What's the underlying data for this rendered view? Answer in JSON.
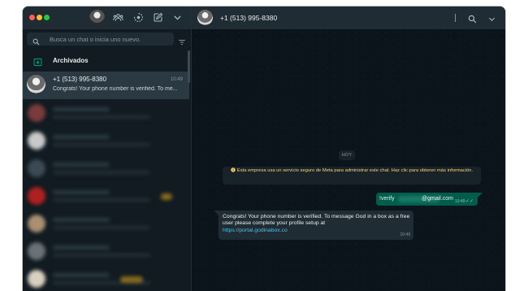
{
  "sidebar": {
    "header": {
      "icons": [
        "community-icon",
        "status-icon",
        "new-chat-icon",
        "menu-chevron-icon"
      ]
    },
    "search": {
      "placeholder": "Busca un chat o inicia uno nuevo.",
      "value": ""
    },
    "archived_label": "Archivados",
    "active_chat": {
      "name": "+1 (513) 995-8380",
      "time": "10:49",
      "preview": "Congrats! Your phone number is verified. To me..."
    }
  },
  "conversation": {
    "header": {
      "name": "+1 (513) 995-8380"
    },
    "date_label": "HOY",
    "meta_notice": "Esta empresa usa un servicio seguro de Meta para administrar este chat. Haz clic para obtener más información.",
    "outgoing": {
      "text_start": "!verify",
      "text_end": "@gmail.com",
      "time": "10:49"
    },
    "incoming": {
      "text": "Congrats! Your phone number is verified. To message God in a box as a free user please complete your profile setup at",
      "link": "https://portal.godinabox.co",
      "time": "10:49"
    }
  },
  "colors": {
    "accent": "#00a884",
    "outgoing_bubble": "#005c4b",
    "incoming_bubble": "#202c33",
    "link": "#53bdeb",
    "notice_text": "#ffd279"
  }
}
